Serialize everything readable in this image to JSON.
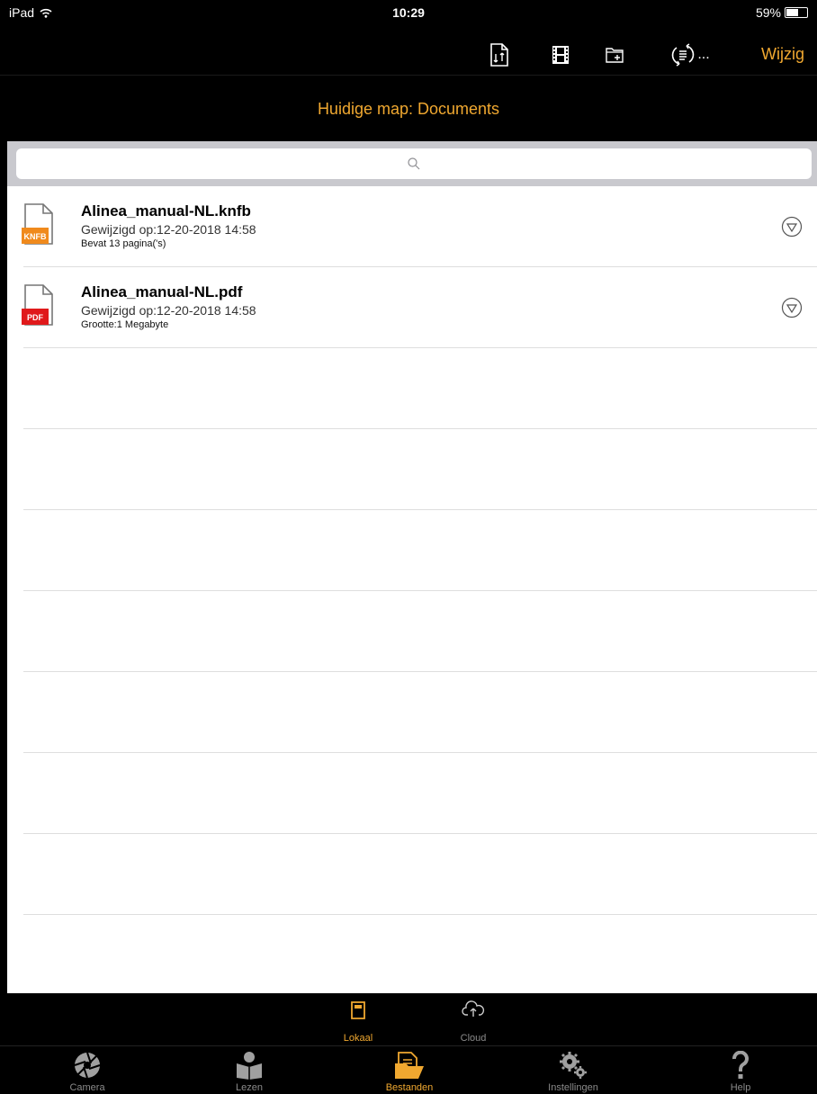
{
  "status_bar": {
    "device": "iPad",
    "time": "10:29",
    "battery": "59%",
    "battery_level": 0.59
  },
  "toolbar": {
    "edit_label": "Wijzig",
    "more_label": "..."
  },
  "folder": {
    "title": "Huidige map: Documents"
  },
  "search": {
    "placeholder": ""
  },
  "files": [
    {
      "name": "Alinea_manual-NL.knfb",
      "modified": "Gewijzigd op:12-20-2018 14:58",
      "info": "Bevat 13 pagina('s)",
      "badge": "KNFB",
      "badge_color": "#f08a1c"
    },
    {
      "name": "Alinea_manual-NL.pdf",
      "modified": "Gewijzigd op:12-20-2018 14:58",
      "info": "Grootte:1 Megabyte",
      "badge": "PDF",
      "badge_color": "#e0191b"
    }
  ],
  "subtabs": [
    {
      "label": "Lokaal",
      "icon": "sd-card-icon",
      "active": true
    },
    {
      "label": "Cloud",
      "icon": "cloud-upload-icon",
      "active": false
    }
  ],
  "tabs": [
    {
      "label": "Camera",
      "icon": "camera-aperture-icon"
    },
    {
      "label": "Lezen",
      "icon": "reading-person-icon"
    },
    {
      "label": "Bestanden",
      "icon": "files-folder-icon",
      "active": true
    },
    {
      "label": "Instellingen",
      "icon": "gears-icon"
    },
    {
      "label": "Help",
      "icon": "question-mark-icon"
    }
  ],
  "colors": {
    "accent": "#f0a830",
    "background": "#000000",
    "list_background": "#ffffff",
    "search_bar": "#c9c9ce"
  }
}
